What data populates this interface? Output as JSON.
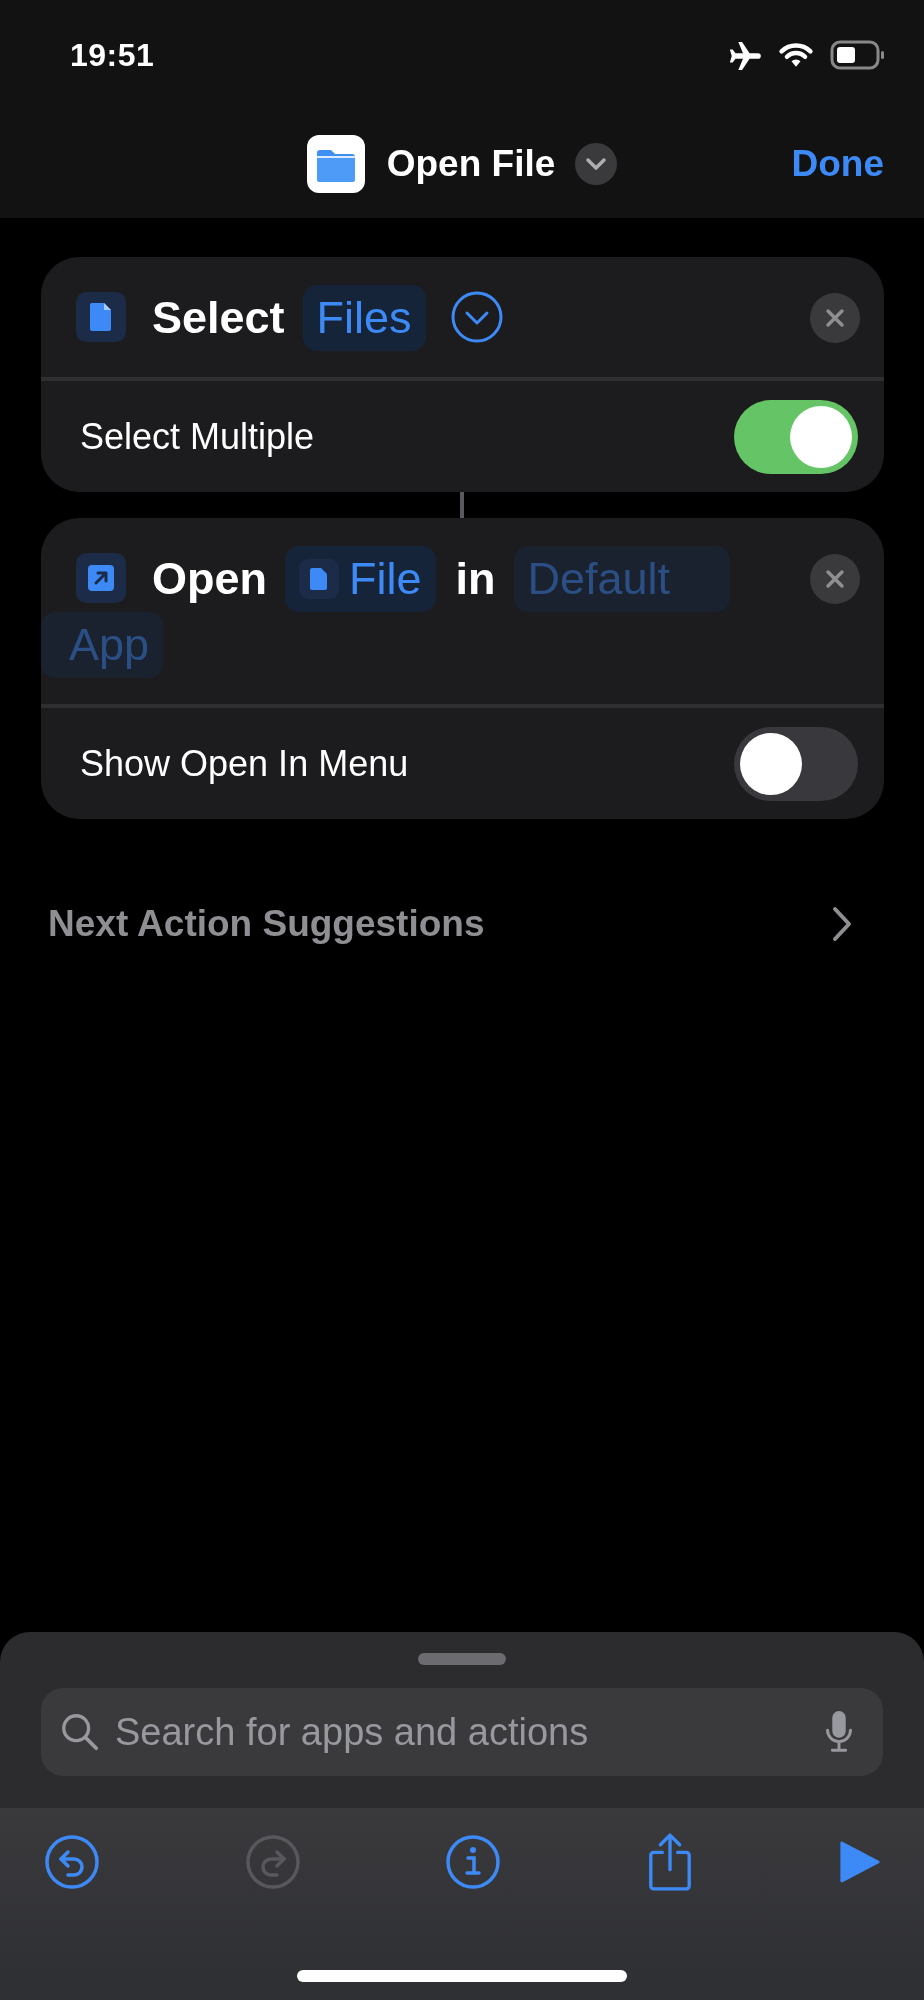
{
  "status_bar": {
    "time": "19:51"
  },
  "nav": {
    "title": "Open File",
    "done": "Done"
  },
  "actions": [
    {
      "kind": "select",
      "parts": [
        {
          "kind": "text",
          "text": "Select"
        },
        {
          "kind": "token",
          "text": "Files",
          "icon": false,
          "dimmed": false
        },
        {
          "kind": "chevron"
        }
      ],
      "option": {
        "label": "Select Multiple",
        "on": true
      }
    },
    {
      "kind": "open",
      "parts": [
        {
          "kind": "text",
          "text": "Open"
        },
        {
          "kind": "token",
          "text": "File",
          "icon": true,
          "dimmed": false
        },
        {
          "kind": "text",
          "text": "in"
        },
        {
          "kind": "token",
          "text": "Default",
          "icon": false,
          "dimmed": true
        },
        {
          "kind": "token",
          "text": "App",
          "icon": false,
          "dimmed": true
        }
      ],
      "option": {
        "label": "Show Open In Menu",
        "on": false
      }
    }
  ],
  "suggestions": {
    "label": "Next Action Suggestions"
  },
  "search": {
    "placeholder": "Search for apps and actions"
  },
  "toolbar": [
    {
      "kind": "undo",
      "disabled": false
    },
    {
      "kind": "redo",
      "disabled": true
    },
    {
      "kind": "info",
      "disabled": false
    },
    {
      "kind": "share",
      "disabled": false
    },
    {
      "kind": "run",
      "disabled": false
    }
  ]
}
